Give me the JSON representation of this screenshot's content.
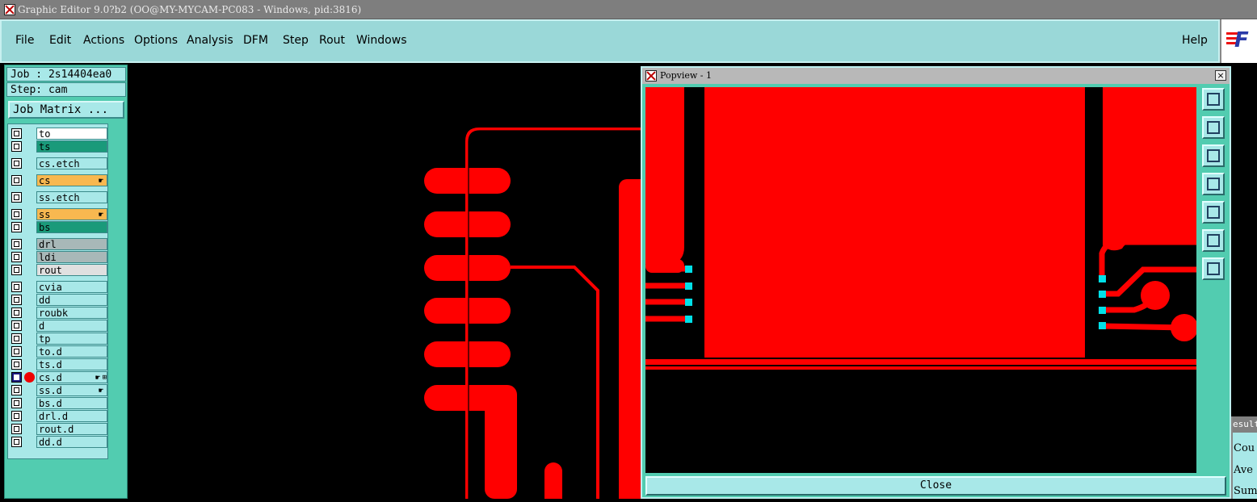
{
  "window": {
    "title": "Graphic Editor 9.0?b2 (OO@MY-MYCAM-PC083 - Windows, pid:3816)"
  },
  "menu": {
    "items": [
      "File",
      "Edit",
      "Actions",
      "Options",
      "Analysis",
      "DFM",
      "Step",
      "Rout",
      "Windows"
    ],
    "help": "Help"
  },
  "logo": {
    "text": "F"
  },
  "job": {
    "job_label": "Job : 2s14404ea0",
    "step_label": "Step: cam",
    "matrix_button": "Job Matrix ..."
  },
  "layers": [
    {
      "name": "to",
      "color": "#ffffff"
    },
    {
      "name": "ts",
      "color": "#1a9a7a"
    },
    {
      "name": "cs.etch",
      "color": "#a8e8e8"
    },
    {
      "name": "cs",
      "color": "#f8b850",
      "mark": "☛"
    },
    {
      "name": "ss.etch",
      "color": "#a8e8e8"
    },
    {
      "name": "ss",
      "color": "#f8b850",
      "mark": "☛"
    },
    {
      "name": "bs",
      "color": "#1a9a7a"
    },
    {
      "name": "drl",
      "color": "#a8b8b8"
    },
    {
      "name": "ldi",
      "color": "#a8b8b8"
    },
    {
      "name": "rout",
      "color": "#e0e0e0"
    },
    {
      "name": "cvia",
      "color": "#a8e8e8"
    },
    {
      "name": "dd",
      "color": "#a8e8e8"
    },
    {
      "name": "roubk",
      "color": "#a8e8e8"
    },
    {
      "name": "d",
      "color": "#a8e8e8"
    },
    {
      "name": "tp",
      "color": "#a8e8e8"
    },
    {
      "name": "to.d",
      "color": "#a8e8e8"
    },
    {
      "name": "ts.d",
      "color": "#a8e8e8"
    },
    {
      "name": "cs.d",
      "color": "#a8e8e8",
      "mark": "☛",
      "mark2": "⊞",
      "selected": true,
      "display": true
    },
    {
      "name": "ss.d",
      "color": "#a8e8e8",
      "mark": "☛"
    },
    {
      "name": "bs.d",
      "color": "#a8e8e8"
    },
    {
      "name": "drl.d",
      "color": "#a8e8e8"
    },
    {
      "name": "rout.d",
      "color": "#a8e8e8"
    },
    {
      "name": "dd.d",
      "color": "#a8e8e8"
    }
  ],
  "popview": {
    "title": "Popview - 1",
    "close_x": "×",
    "close_button": "Close",
    "tools": [
      "zoom-window-icon",
      "pan-up-icon",
      "pan-down-icon",
      "pan-left-icon",
      "pan-right-icon",
      "zoom-fit-icon",
      "zoom-center-icon"
    ]
  },
  "results": {
    "title": "esult",
    "lines": [
      "Cou",
      "Ave",
      "Sum"
    ]
  },
  "colors": {
    "copper": "#ff0000",
    "pad_cyan": "#00e0e8",
    "panel": "#52ccb0",
    "widget": "#a8e8e8"
  }
}
